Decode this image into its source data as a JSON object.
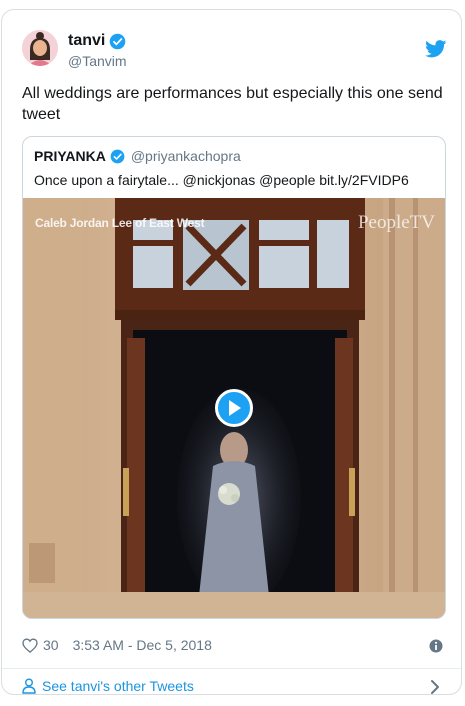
{
  "tweet": {
    "display_name": "tanvi",
    "handle": "@Tanvim",
    "text": "All weddings are performances but especially this one send tweet",
    "likes": "30",
    "timestamp": "3:53 AM - Dec 5, 2018"
  },
  "quoted": {
    "display_name": "PRIYANKA",
    "handle": "@priyankachopra",
    "text": "Once upon a fairytale... @nickjonas @people bit.ly/2FVIDP6",
    "video_caption_left": "Caleb Jordan Lee of East West",
    "video_watermark": "PeopleTV"
  },
  "footer": {
    "link_label": "See tanvi's other Tweets"
  },
  "colors": {
    "accent": "#1da1f2",
    "link": "#1b95e0",
    "muted": "#657786"
  },
  "icons": [
    "verified-badge-icon",
    "twitter-bird-icon",
    "play-icon",
    "heart-icon",
    "info-icon",
    "user-icon",
    "chevron-right-icon"
  ]
}
